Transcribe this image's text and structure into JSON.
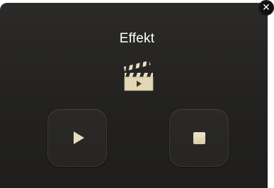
{
  "dialog": {
    "title": "Effekt",
    "close_icon": "close-icon",
    "media_icon": "clapperboard-icon"
  },
  "controls": {
    "play_icon": "play-icon",
    "stop_icon": "stop-icon"
  },
  "colors": {
    "panel_background": "#252422",
    "button_background": "#282725",
    "icon_cream": "#e6dcbd",
    "title_text": "#ffffff"
  }
}
